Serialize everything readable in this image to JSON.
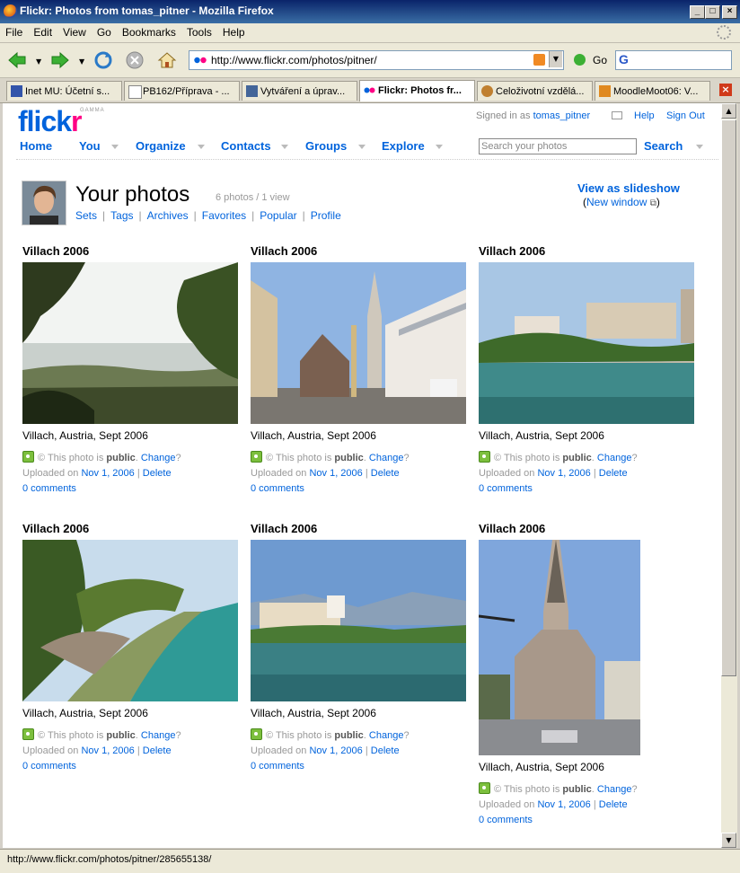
{
  "window": {
    "title": "Flickr: Photos from tomas_pitner - Mozilla Firefox"
  },
  "menu": [
    "File",
    "Edit",
    "View",
    "Go",
    "Bookmarks",
    "Tools",
    "Help"
  ],
  "address": {
    "url": "http://www.flickr.com/photos/pitner/",
    "go_label": "Go"
  },
  "tabs": [
    {
      "label": "Inet MU: Účetní s..."
    },
    {
      "label": "PB162/Příprava - ..."
    },
    {
      "label": "Vytváření a úprav..."
    },
    {
      "label": "Flickr: Photos fr..."
    },
    {
      "label": "Celoživotní vzdělá..."
    },
    {
      "label": "MoodleMoot06: V..."
    }
  ],
  "flickr": {
    "logo_a": "flick",
    "logo_b": "r",
    "gamma": "GAMMA",
    "signed_in_prefix": "Signed in as",
    "username": "tomas_pitner",
    "help": "Help",
    "sign_out": "Sign Out",
    "nav": [
      "Home",
      "You",
      "Organize",
      "Contacts",
      "Groups",
      "Explore"
    ],
    "search_placeholder": "Search your photos",
    "search_button": "Search"
  },
  "page": {
    "title": "Your photos",
    "count": "6 photos / 1 view",
    "sublinks": [
      "Sets",
      "Tags",
      "Archives",
      "Favorites",
      "Popular",
      "Profile"
    ],
    "slideshow": "View as slideshow",
    "new_window_open": "(",
    "new_window": "New window",
    "new_window_close": ")"
  },
  "photos": [
    {
      "title": "Villach 2006",
      "desc": "Villach, Austria, Sept 2006",
      "privacy_prefix": "© This photo is",
      "privacy": "public",
      "change": "Change",
      "uploaded": "Uploaded on",
      "date": "Nov 1, 2006",
      "delete": "Delete",
      "comments": "0 comments"
    },
    {
      "title": "Villach 2006",
      "desc": "Villach, Austria, Sept 2006",
      "privacy_prefix": "© This photo is",
      "privacy": "public",
      "change": "Change",
      "uploaded": "Uploaded on",
      "date": "Nov 1, 2006",
      "delete": "Delete",
      "comments": "0 comments"
    },
    {
      "title": "Villach 2006",
      "desc": "Villach, Austria, Sept 2006",
      "privacy_prefix": "© This photo is",
      "privacy": "public",
      "change": "Change",
      "uploaded": "Uploaded on",
      "date": "Nov 1, 2006",
      "delete": "Delete",
      "comments": "0 comments"
    },
    {
      "title": "Villach 2006",
      "desc": "Villach, Austria, Sept 2006",
      "privacy_prefix": "© This photo is",
      "privacy": "public",
      "change": "Change",
      "uploaded": "Uploaded on",
      "date": "Nov 1, 2006",
      "delete": "Delete",
      "comments": "0 comments"
    },
    {
      "title": "Villach 2006",
      "desc": "Villach, Austria, Sept 2006",
      "privacy_prefix": "© This photo is",
      "privacy": "public",
      "change": "Change",
      "uploaded": "Uploaded on",
      "date": "Nov 1, 2006",
      "delete": "Delete",
      "comments": "0 comments"
    },
    {
      "title": "Villach 2006",
      "desc": "Villach, Austria, Sept 2006",
      "privacy_prefix": "© This photo is",
      "privacy": "public",
      "change": "Change",
      "uploaded": "Uploaded on",
      "date": "Nov 1, 2006",
      "delete": "Delete",
      "comments": "0 comments"
    }
  ],
  "status": {
    "text": "http://www.flickr.com/photos/pitner/285655138/"
  },
  "colors": {
    "flickr_blue": "#0063dc",
    "flickr_pink": "#ff0084",
    "titlebar": "#0a246a"
  }
}
